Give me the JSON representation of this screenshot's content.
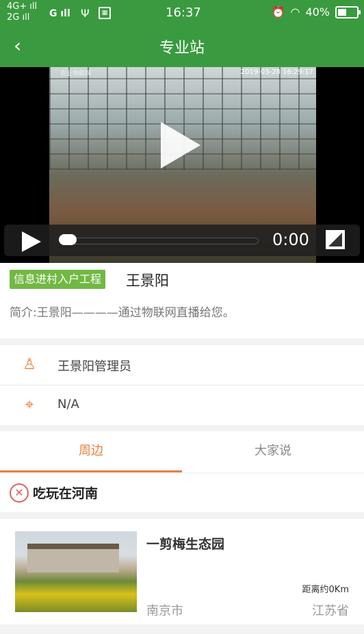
{
  "status_bar": {
    "net1": "4G+",
    "net2": "2G",
    "net3": "G",
    "time": "16:37",
    "battery": "40%",
    "icons": [
      "signal-icon",
      "usb-icon",
      "alarm-icon",
      "wifi-icon",
      "battery-icon"
    ]
  },
  "navbar": {
    "title": "专业站"
  },
  "video": {
    "overlay_timestamp": "2019-03-28 16:29:17",
    "time": "0:00",
    "progress": 0
  },
  "station": {
    "tag": "信息进村入户工程",
    "name": "王景阳",
    "intro": "简介:王景阳————通过物联网直播给您。"
  },
  "details": {
    "manager": "王景阳管理员",
    "address": "N/A"
  },
  "tabs": [
    {
      "label": "周边"
    },
    {
      "label": "大家说"
    }
  ],
  "category": {
    "label": "吃玩在河南"
  },
  "listing": {
    "title": "一剪梅生态园",
    "distance": "距离约0Km",
    "city": "南京市",
    "province": "江苏省"
  },
  "colors": {
    "primary_green": "#3a9a3f",
    "tag_green": "#71b942",
    "accent_orange": "#e8803a"
  }
}
